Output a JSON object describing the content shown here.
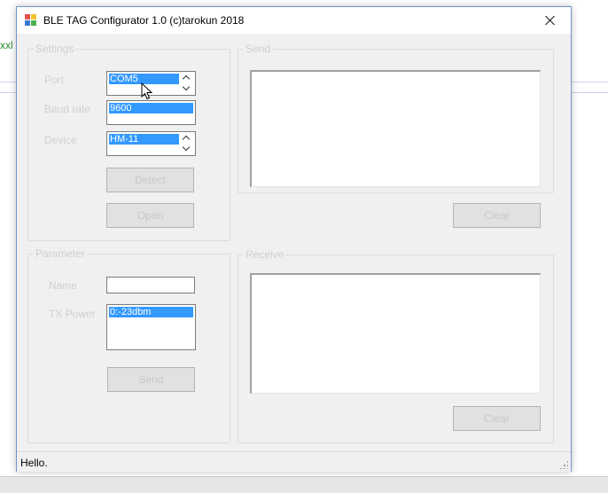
{
  "background": {
    "fragment_text": "xxl"
  },
  "window": {
    "title": "BLE TAG Configurator 1.0 (c)tarokun 2018",
    "icon": "app-icon",
    "close_icon": "close-icon"
  },
  "settings": {
    "title": "Settings",
    "port": {
      "label": "Port",
      "value": "COM5"
    },
    "baud": {
      "label": "Baud rate",
      "value": "9600"
    },
    "device": {
      "label": "Device",
      "value": "HM-11"
    },
    "detect_label": "Detect",
    "open_label": "Open"
  },
  "send": {
    "title": "Send",
    "content": "",
    "clear_label": "Clear"
  },
  "parameter": {
    "title": "Parameter",
    "name_label": "Name",
    "name_value": "",
    "tx_label": "TX Power",
    "tx_value": "0:-23dbm",
    "send_label": "Send"
  },
  "receive": {
    "title": "Receive",
    "content": "",
    "clear_label": "Clear"
  },
  "status": {
    "text": "Hello."
  },
  "colors": {
    "accent": "#3399ff",
    "window_border": "#6f95c9",
    "surface": "#f0f0f0"
  }
}
